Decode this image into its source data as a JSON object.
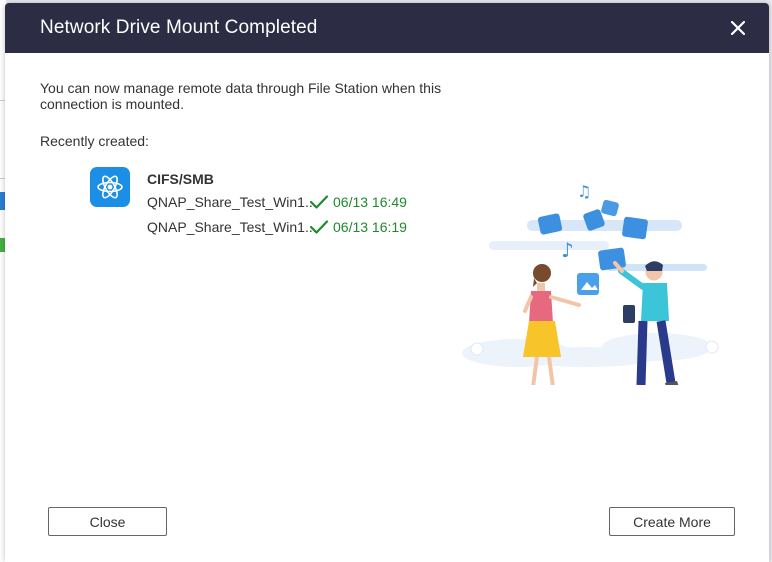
{
  "dialog": {
    "title": "Network Drive Mount Completed",
    "intro": "You can now manage remote data through File Station when this connection is mounted.",
    "recent_label": "Recently created:",
    "protocol": "CIFS/SMB",
    "entries": [
      {
        "name": "QNAP_Share_Test_Win1...",
        "time": "06/13 16:49"
      },
      {
        "name": "QNAP_Share_Test_Win1...",
        "time": "06/13 16:19"
      }
    ],
    "buttons": {
      "close": "Close",
      "create_more": "Create More"
    }
  },
  "colors": {
    "titlebar": "#2c2c44",
    "success": "#1f8a2e",
    "icon_blue": "#1b8ee6"
  },
  "icons": {
    "close": "close-icon",
    "protocol": "atom-icon",
    "status": "checkmark-icon"
  }
}
